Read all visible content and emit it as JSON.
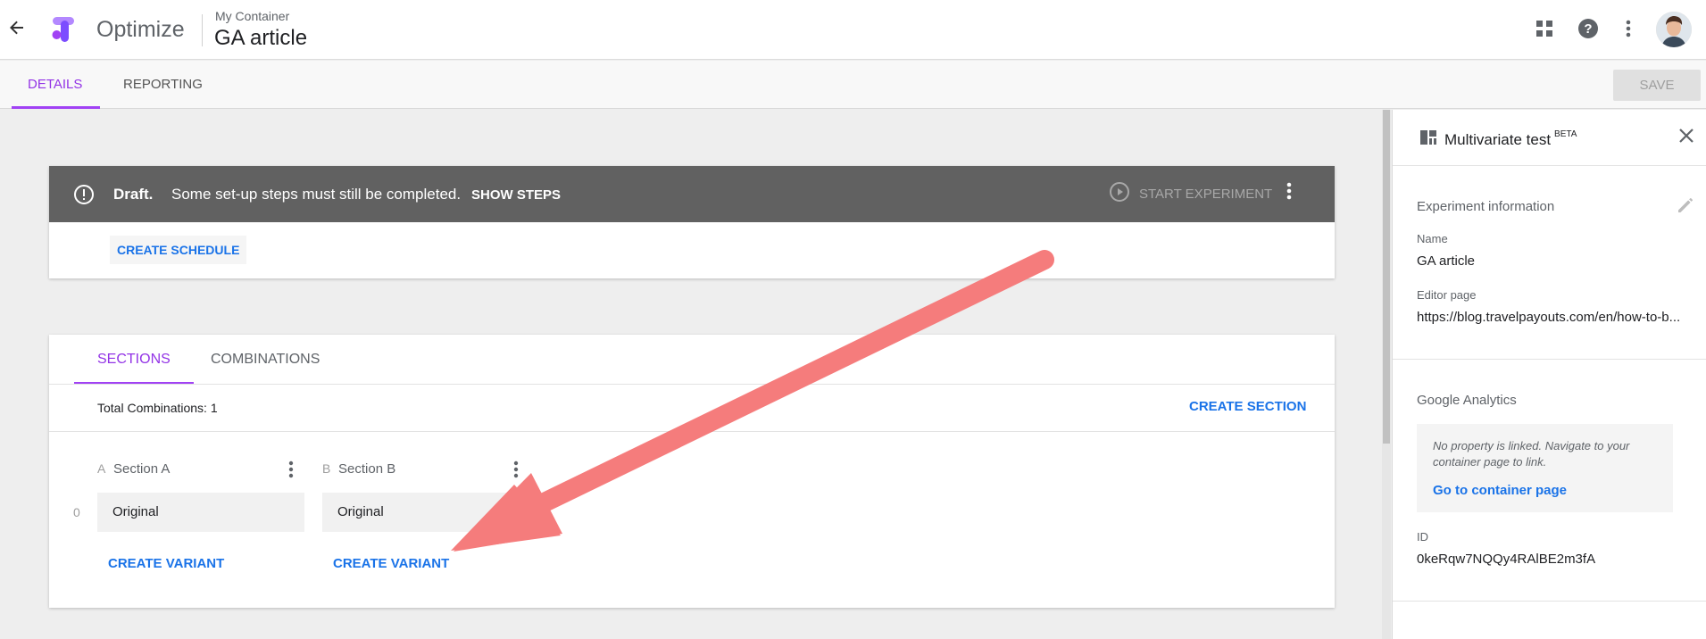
{
  "header": {
    "app_name": "Optimize",
    "container_label": "My Container",
    "container_title": "GA article"
  },
  "tabs": [
    {
      "label": "Details",
      "active": true
    },
    {
      "label": "Reporting",
      "active": false
    }
  ],
  "save_label": "Save",
  "draft_bar": {
    "strong": "Draft.",
    "message": "Some set-up steps must still be completed.",
    "show_steps": "Show steps",
    "start_experiment": "Start experiment"
  },
  "create_schedule": "Create schedule",
  "sections_card": {
    "tabs": [
      {
        "label": "Sections",
        "active": true
      },
      {
        "label": "Combinations",
        "active": false
      }
    ],
    "total_combinations": "Total Combinations: 1",
    "create_section": "Create section",
    "row_index": "0",
    "sections": [
      {
        "letter": "A",
        "name": "Section A",
        "variant": "Original",
        "create_variant": "Create variant"
      },
      {
        "letter": "B",
        "name": "Section B",
        "variant": "Original",
        "create_variant": "Create variant"
      }
    ]
  },
  "right_panel": {
    "title": "Multivariate test",
    "badge": "BETA",
    "experiment_info_title": "Experiment information",
    "name_label": "Name",
    "name_value": "GA article",
    "editor_label": "Editor page",
    "editor_value": "https://blog.travelpayouts.com/en/how-to-b...",
    "ga_title": "Google Analytics",
    "ga_notice": "No property is linked. Navigate to your container page to link.",
    "ga_link": "Go to container page",
    "id_label": "ID",
    "id_value": "0keRqw7NQQy4RAlBE2m3fA"
  },
  "colors": {
    "accent_purple": "#a142f4",
    "link_blue": "#1a73e8",
    "draft_bar": "#616161",
    "annotation_arrow": "#f57c7c"
  },
  "icons": [
    "arrow-back-icon",
    "optimize-logo-icon",
    "apps-grid-icon",
    "help-icon",
    "more-vert-icon",
    "warning-icon",
    "play-circle-icon",
    "multivariate-icon",
    "close-icon",
    "edit-pencil-icon"
  ]
}
